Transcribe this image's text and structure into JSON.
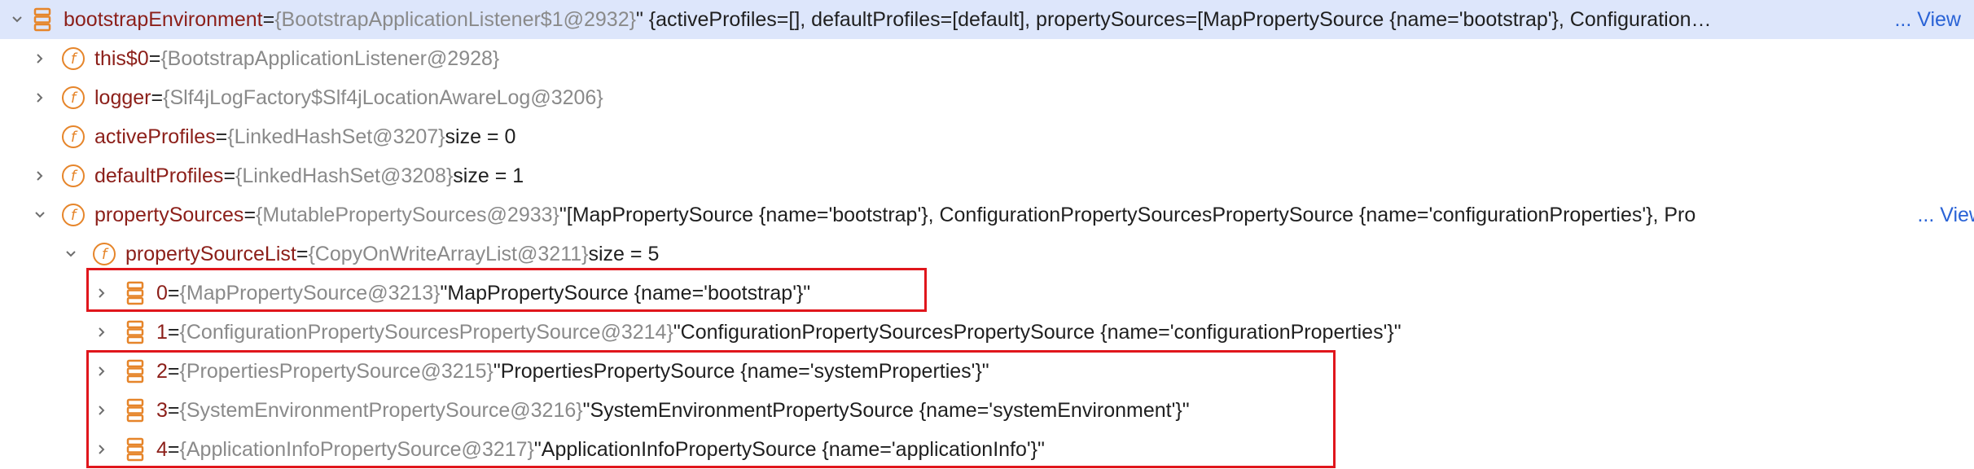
{
  "colors": {
    "field_name": "#8c1f19",
    "type_ref": "#8a8a8a",
    "field_icon": "#e6852a",
    "list_icon": "#e6852a",
    "link": "#2a63d6",
    "selection": "#dde6fb",
    "highlight_box": "#e0161c"
  },
  "icons": {
    "expand": "chevron-right-icon",
    "collapse": "chevron-down-icon",
    "field": "field-f-icon",
    "list": "list-stack-icon"
  },
  "rows": {
    "r0": {
      "name": "bootstrapEnvironment",
      "eq": " = ",
      "type": "{BootstrapApplicationListener$1@2932}",
      "value": " \" {activeProfiles=[], defaultProfiles=[default], propertySources=[MapPropertySource {name='bootstrap'}, ConfigurationPropertySourcesPropertySource {name='configurationProperties'}",
      "view": "... View"
    },
    "r1": {
      "name": "this$0",
      "eq": " = ",
      "type": "{BootstrapApplicationListener@2928}"
    },
    "r2": {
      "name": "logger",
      "eq": " = ",
      "type": "{Slf4jLogFactory$Slf4jLocationAwareLog@3206}"
    },
    "r3": {
      "name": "activeProfiles",
      "eq": " = ",
      "type": "{LinkedHashSet@3207}",
      "size": "  size = 0"
    },
    "r4": {
      "name": "defaultProfiles",
      "eq": " = ",
      "type": "{LinkedHashSet@3208}",
      "size": "  size = 1"
    },
    "r5": {
      "name": "propertySources",
      "eq": " = ",
      "type": "{MutablePropertySources@2933}",
      "value": " \"[MapPropertySource {name='bootstrap'}, ConfigurationPropertySourcesPropertySource {name='configurationProperties'}, Pro",
      "view": "... View"
    },
    "r6": {
      "name": "propertySourceList",
      "eq": " = ",
      "type": "{CopyOnWriteArrayList@3211}",
      "size": "  size = 5"
    },
    "r7": {
      "name": "0",
      "eq": " = ",
      "type": "{MapPropertySource@3213}",
      "value": " \"MapPropertySource {name='bootstrap'}\""
    },
    "r8": {
      "name": "1",
      "eq": " = ",
      "type": "{ConfigurationPropertySourcesPropertySource@3214}",
      "value": " \"ConfigurationPropertySourcesPropertySource {name='configurationProperties'}\""
    },
    "r9": {
      "name": "2",
      "eq": " = ",
      "type": "{PropertiesPropertySource@3215}",
      "value": " \"PropertiesPropertySource {name='systemProperties'}\""
    },
    "r10": {
      "name": "3",
      "eq": " = ",
      "type": "{SystemEnvironmentPropertySource@3216}",
      "value": " \"SystemEnvironmentPropertySource {name='systemEnvironment'}\""
    },
    "r11": {
      "name": "4",
      "eq": " = ",
      "type": "{ApplicationInfoPropertySource@3217}",
      "value": " \"ApplicationInfoPropertySource {name='applicationInfo'}\""
    }
  }
}
